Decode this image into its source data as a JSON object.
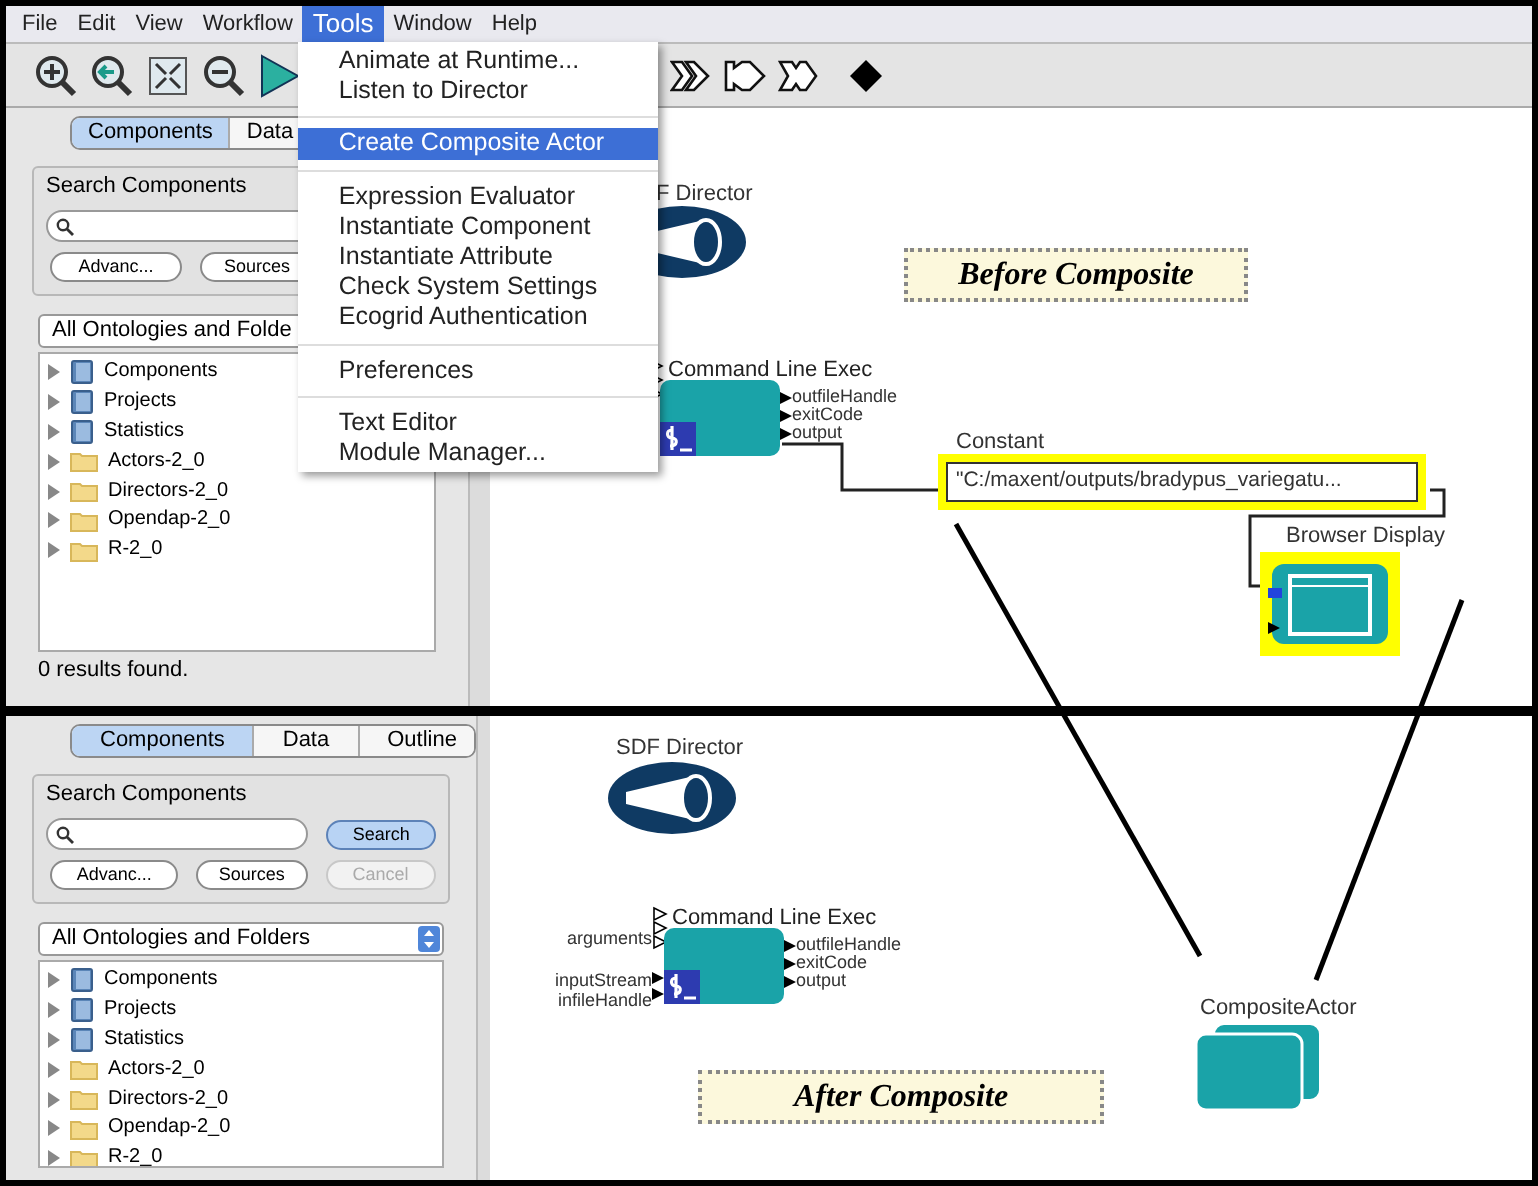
{
  "top": {
    "menu_bar": [
      {
        "label": "File",
        "selected": false
      },
      {
        "label": "Edit",
        "selected": false
      },
      {
        "label": "View",
        "selected": false
      },
      {
        "label": "Workflow",
        "selected": false
      },
      {
        "label": "Tools",
        "selected": true
      },
      {
        "label": "Window",
        "selected": false
      },
      {
        "label": "Help",
        "selected": false
      }
    ],
    "tools_menu": [
      [
        {
          "label": "Animate at Runtime...",
          "selected": false
        },
        {
          "label": "Listen to Director",
          "selected": false
        }
      ],
      [
        {
          "label": "Create Composite Actor",
          "selected": true
        }
      ],
      [
        {
          "label": "Expression Evaluator",
          "selected": false
        },
        {
          "label": "Instantiate Component",
          "selected": false
        },
        {
          "label": "Instantiate Attribute",
          "selected": false
        },
        {
          "label": "Check System Settings",
          "selected": false
        },
        {
          "label": "Ecogrid Authentication",
          "selected": false
        }
      ],
      [
        {
          "label": "Preferences",
          "selected": false
        }
      ],
      [
        {
          "label": "Text Editor",
          "selected": false
        },
        {
          "label": "Module Manager...",
          "selected": false
        }
      ]
    ],
    "panel": {
      "tabs": [
        {
          "label": "Components",
          "selected": true
        },
        {
          "label": "Data",
          "selected": false
        }
      ],
      "search_title": "Search Components",
      "buttons": [
        {
          "label": "Advanc...",
          "selected": false,
          "disabled": false
        },
        {
          "label": "Sources",
          "selected": false,
          "disabled": false
        }
      ],
      "dropdown": "All Ontologies and Folde",
      "tree": [
        {
          "label": "Components",
          "kind": "library"
        },
        {
          "label": "Projects",
          "kind": "library"
        },
        {
          "label": "Statistics",
          "kind": "library"
        },
        {
          "label": "Actors-2_0",
          "kind": "folder"
        },
        {
          "label": "Directors-2_0",
          "kind": "folder"
        },
        {
          "label": "Opendap-2_0",
          "kind": "folder"
        },
        {
          "label": "R-2_0",
          "kind": "folder"
        }
      ],
      "status": "0 results found."
    },
    "canvas": {
      "director": "F Director",
      "note": "Before Composite",
      "actor": {
        "title": "Command Line Exec",
        "outputs": [
          "outfileHandle",
          "exitCode",
          "output"
        ]
      },
      "constant": {
        "title": "Constant",
        "value": "\"C:/maxent/outputs/bradypus_variegatu...",
        "selected": true
      },
      "display": {
        "title": "Browser Display",
        "selected": true
      }
    }
  },
  "bottom": {
    "panel": {
      "tabs": [
        {
          "label": "Components",
          "selected": true
        },
        {
          "label": "Data",
          "selected": false
        },
        {
          "label": "Outline",
          "selected": false
        }
      ],
      "search_title": "Search Components",
      "buttons": [
        {
          "label": "Search",
          "selected": true,
          "disabled": false
        },
        {
          "label": "Advanc...",
          "selected": false,
          "disabled": false
        },
        {
          "label": "Sources",
          "selected": false,
          "disabled": false
        },
        {
          "label": "Cancel",
          "selected": false,
          "disabled": true
        }
      ],
      "dropdown": "All Ontologies and Folders",
      "tree": [
        {
          "label": "Components",
          "kind": "library"
        },
        {
          "label": "Projects",
          "kind": "library"
        },
        {
          "label": "Statistics",
          "kind": "library"
        },
        {
          "label": "Actors-2_0",
          "kind": "folder"
        },
        {
          "label": "Directors-2_0",
          "kind": "folder"
        },
        {
          "label": "Opendap-2_0",
          "kind": "folder"
        },
        {
          "label": "R-2_0",
          "kind": "folder"
        }
      ]
    },
    "canvas": {
      "director": "SDF Director",
      "note": "After Composite",
      "actor": {
        "title": "Command Line Exec",
        "inputs": [
          "arguments",
          "inputStream",
          "infileHandle"
        ],
        "outputs": [
          "outfileHandle",
          "exitCode",
          "output"
        ]
      },
      "composite": {
        "title": "CompositeActor",
        "selected": false
      }
    }
  }
}
